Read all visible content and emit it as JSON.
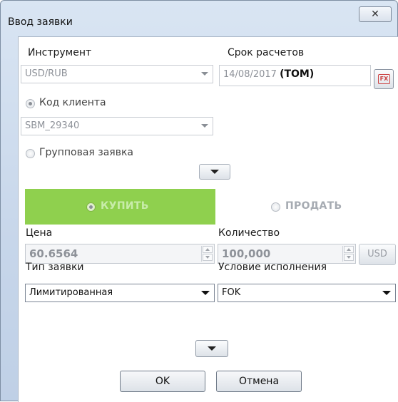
{
  "window": {
    "title": "Ввод заявки",
    "close_glyph": "✕"
  },
  "instrument": {
    "label": "Инструмент",
    "value": "USD/RUB"
  },
  "settlement": {
    "label": "Срок расчетов",
    "date": "14/08/2017",
    "code": "(TOM)",
    "button_icon": "FX"
  },
  "client_code": {
    "label": "Код клиента",
    "value": "SBM_29340",
    "selected": true
  },
  "group_order": {
    "label": "Групповая заявка",
    "selected": false
  },
  "side": {
    "buy_label": "КУПИТЬ",
    "sell_label": "ПРОДАТЬ",
    "selected": "buy",
    "buy_color": "#8fd04e"
  },
  "price": {
    "label": "Цена",
    "value": "60.6564"
  },
  "quantity": {
    "label": "Количество",
    "value": "100,000",
    "currency_button": "USD"
  },
  "order_type": {
    "label": "Тип заявки",
    "value": "Лимитированная"
  },
  "execution": {
    "label": "Условие исполнения",
    "value": "FOK"
  },
  "buttons": {
    "ok": "OK",
    "cancel": "Отмена"
  }
}
